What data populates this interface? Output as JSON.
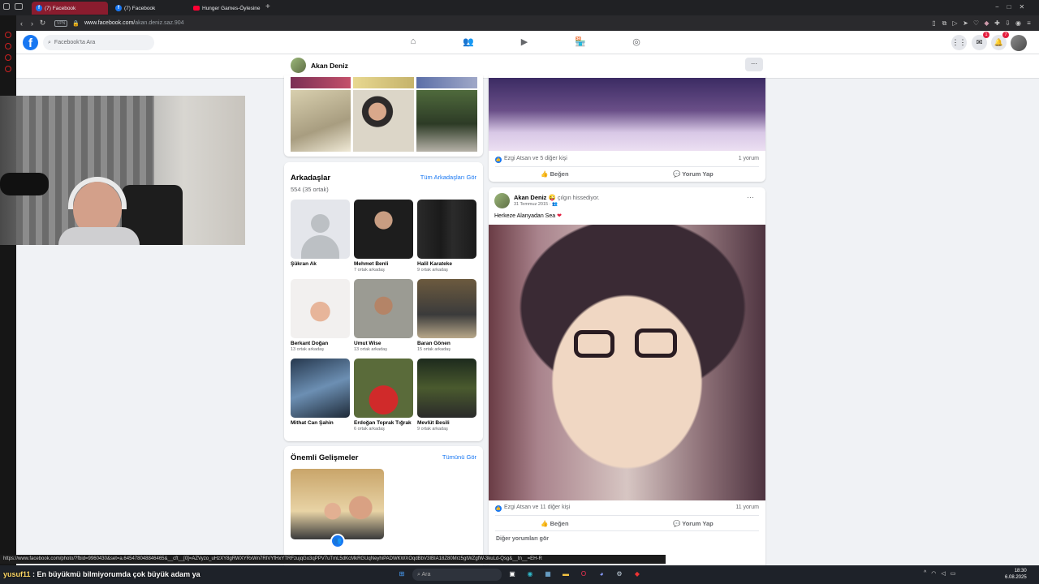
{
  "browser": {
    "tabs": [
      {
        "title": "(7) Facebook",
        "active": true
      },
      {
        "title": "(7) Facebook",
        "active": false
      },
      {
        "title": "Hunger Games-Öylesine",
        "active": false
      }
    ],
    "new_tab_label": "+",
    "url_prefix": "www.facebook.com/",
    "url_path": "akan.deniz.saz.904"
  },
  "facebook": {
    "logo": "f",
    "search_placeholder": "Facebook'ta Ara",
    "messenger_badge": "1",
    "notifications_badge": "7",
    "profile_name": "Akan Deniz",
    "more_label": "···",
    "friends": {
      "title": "Arkadaşlar",
      "count": "554 (35 ortak)",
      "see_all": "Tüm Arkadaşları Gör",
      "items": [
        {
          "name": "Şükran Ak",
          "mutual": ""
        },
        {
          "name": "Mehmet Benli",
          "mutual": "7 ortak arkadaş"
        },
        {
          "name": "Halil Karateke",
          "mutual": "9 ortak arkadaş"
        },
        {
          "name": "Berkant Doğan",
          "mutual": "13 ortak arkadaş"
        },
        {
          "name": "Umut Wise",
          "mutual": "13 ortak arkadaş"
        },
        {
          "name": "Baran Gönen",
          "mutual": "15 ortak arkadaş"
        },
        {
          "name": "Mithat Can Şahin",
          "mutual": ""
        },
        {
          "name": "Erdoğan Toprak Tığrak",
          "mutual": "6 ortak arkadaş"
        },
        {
          "name": "Mevlüt Besili",
          "mutual": "9 ortak arkadaş"
        }
      ]
    },
    "featured": {
      "title": "Önemli Gelişmeler",
      "see_all": "Tümünü Gör"
    },
    "post1": {
      "reactions": "Ezgi Atsan ve 5 diğer kişi",
      "comments": "1 yorum",
      "like": "Beğen",
      "comment": "Yorum Yap"
    },
    "post2": {
      "author": "Akan Deniz",
      "feeling": "çılgın hissediyor.",
      "date": "31 Temmuz 2015",
      "text": "Herkeze Alanyadan Sea",
      "reactions": "Ezgi Atsan ve 11 diğer kişi",
      "comments": "11 yorum",
      "like": "Beğen",
      "comment": "Yorum Yap",
      "more_comments": "Diğer yorumları gör",
      "more_label": "···"
    }
  },
  "status_url": "https://www.facebook.com/photo/?fbid=9960430&set=a.645478048846465&__cft__[0]=AZVyzo_uHzXY8gRWXYRxWn7RIVYfHxYTRFzujqGo3qPPV7uTmL5dKcMkRGUqNeyhiPADWKWXOqdBbV3IBIA18Z80Mrz5gtWZgfW-3kuLd-Qsg&__tn__=EH-R",
  "stream_caption": "En büyükmü bilmiyorumda çok büyük adam ya",
  "stream_user": "yusuf11",
  "taskbar": {
    "search": "Ara",
    "time": "18:30",
    "date": "6.08.2025"
  }
}
